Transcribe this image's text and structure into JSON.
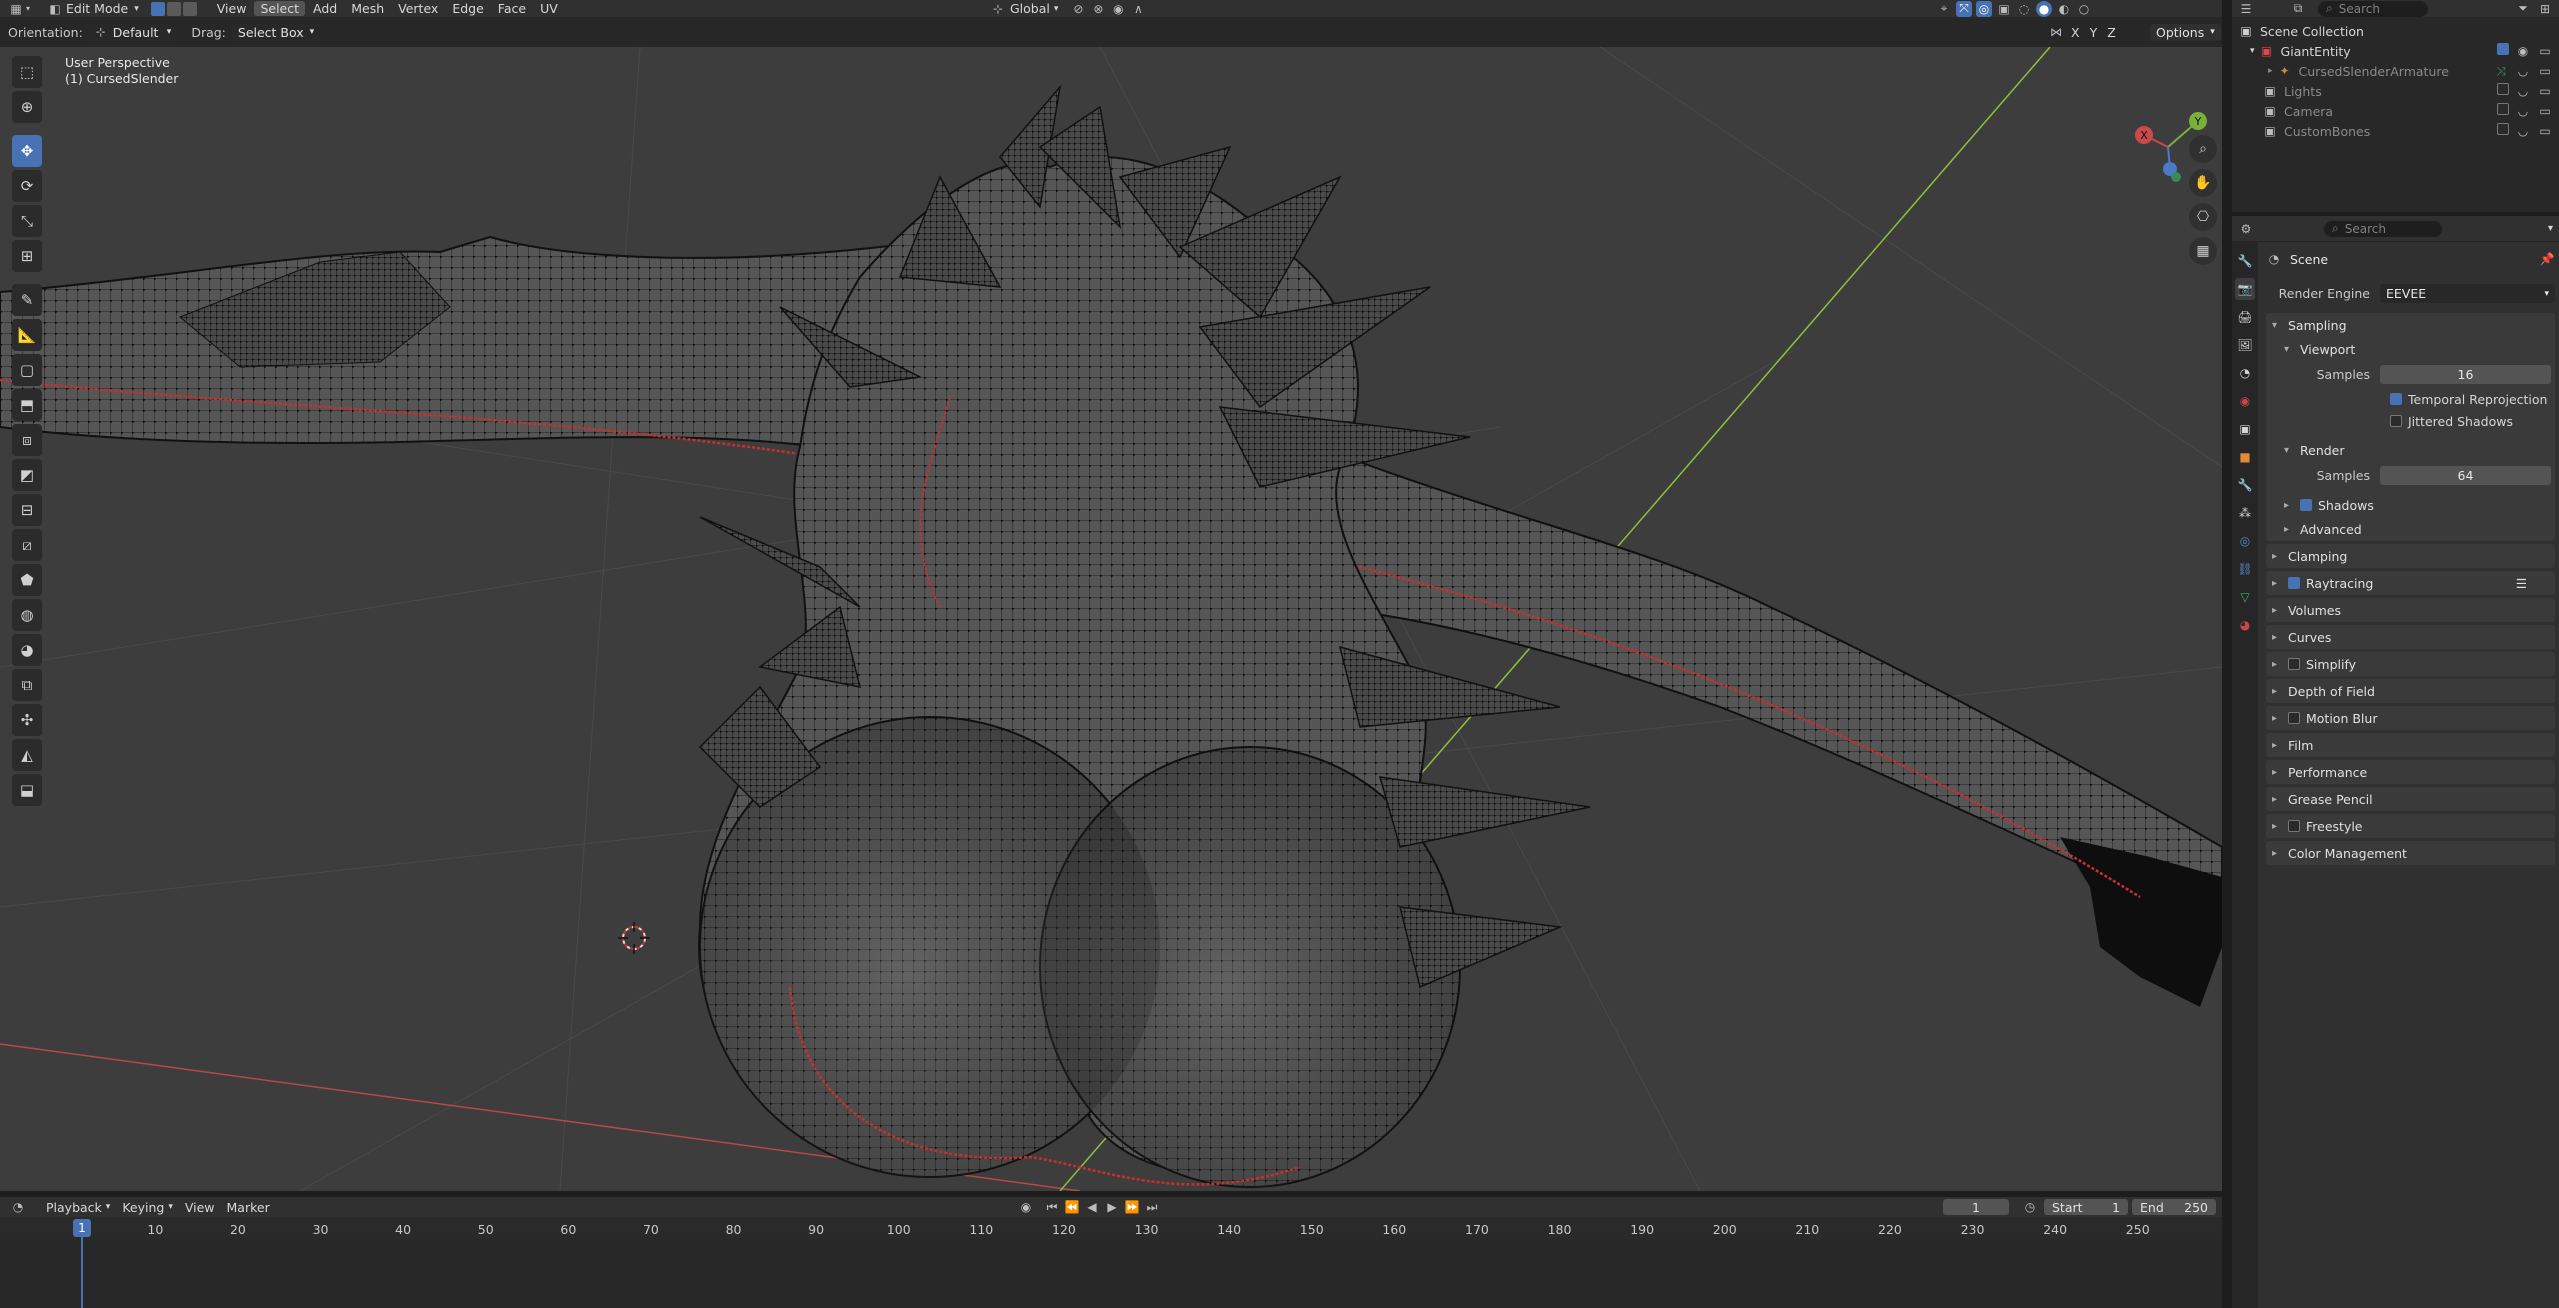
{
  "topbar": {
    "editor_icon": "cube-icon",
    "mode": "Edit Mode",
    "menus": [
      "View",
      "Select",
      "Add",
      "Mesh",
      "Vertex",
      "Edge",
      "Face",
      "UV"
    ],
    "active_menu": "Select",
    "transform_orientation": "Global",
    "options_label": "Options"
  },
  "header2": {
    "orientation_label": "Orientation:",
    "orientation_value": "Default",
    "drag_label": "Drag:",
    "drag_value": "Select Box"
  },
  "viewport": {
    "perspective_label": "User Perspective",
    "object_label": "(1) CursedSlender",
    "gizmo_axes": {
      "x": "X",
      "y": "Y"
    },
    "colors": {
      "background": "#3d3d3d",
      "x_axis": "#c94040",
      "y_axis": "#8fbf3a",
      "seam": "#d03030"
    }
  },
  "toolbar": {
    "tools": [
      "select-box-icon",
      "cursor-icon",
      "move-icon",
      "rotate-icon",
      "scale-icon",
      "transform-icon",
      "annotate-icon",
      "measure-icon",
      "add-cube-icon",
      "extrude-icon",
      "inset-icon",
      "bevel-icon",
      "loop-cut-icon",
      "knife-icon",
      "poly-build-icon",
      "spin-icon",
      "smooth-icon",
      "edge-slide-icon",
      "shrink-icon",
      "shear-icon",
      "rip-icon"
    ]
  },
  "outliner": {
    "search_placeholder": "Search",
    "items": [
      {
        "label": "Scene Collection",
        "level": 0
      },
      {
        "label": "GiantEntity",
        "level": 1
      },
      {
        "label": "CursedSlenderArmature",
        "level": 2
      },
      {
        "label": "Lights",
        "level": 1
      },
      {
        "label": "Camera",
        "level": 1
      },
      {
        "label": "CustomBones",
        "level": 1
      }
    ]
  },
  "properties": {
    "search_placeholder": "Search",
    "context": "Scene",
    "render_engine_label": "Render Engine",
    "render_engine_value": "EEVEE",
    "sampling": {
      "title": "Sampling",
      "viewport": {
        "title": "Viewport",
        "samples_label": "Samples",
        "samples_value": "16",
        "temporal_reprojection": "Temporal Reprojection",
        "jittered_shadows": "Jittered Shadows"
      },
      "render": {
        "title": "Render",
        "samples_label": "Samples",
        "samples_value": "64"
      },
      "shadows": "Shadows",
      "advanced": "Advanced"
    },
    "panels": [
      "Clamping",
      "Raytracing",
      "Volumes",
      "Curves",
      "Simplify",
      "Depth of Field",
      "Motion Blur",
      "Film",
      "Performance",
      "Grease Pencil",
      "Freestyle",
      "Color Management"
    ]
  },
  "timeline": {
    "menus": [
      "Playback",
      "Keying",
      "View",
      "Marker"
    ],
    "current_frame": "1",
    "start_label": "Start",
    "start_value": "1",
    "end_label": "End",
    "end_value": "250",
    "playhead": "1",
    "ticks": [
      "10",
      "20",
      "30",
      "40",
      "50",
      "60",
      "70",
      "80",
      "90",
      "100",
      "110",
      "120",
      "130",
      "140",
      "150",
      "160",
      "170",
      "180",
      "190",
      "200",
      "210",
      "220",
      "230",
      "240",
      "250"
    ]
  }
}
